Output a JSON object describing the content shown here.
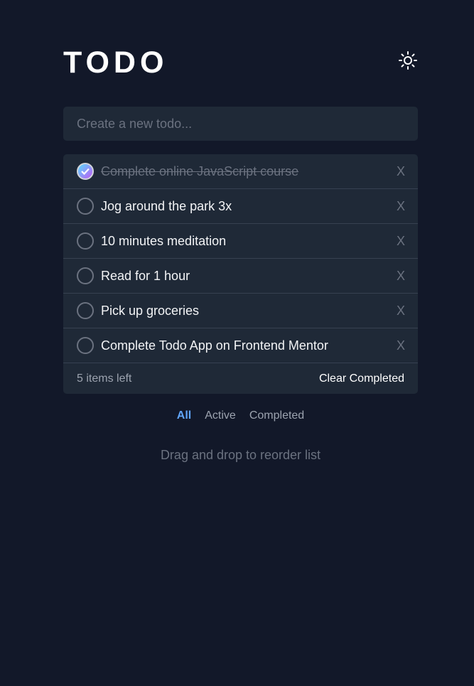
{
  "header": {
    "title": "TODO",
    "theme_icon": "sun-icon"
  },
  "new_todo": {
    "placeholder": "Create a new todo..."
  },
  "todos": [
    {
      "text": "Complete online JavaScript course",
      "completed": true,
      "delete_label": "X"
    },
    {
      "text": "Jog around the park 3x",
      "completed": false,
      "delete_label": "X"
    },
    {
      "text": "10 minutes meditation",
      "completed": false,
      "delete_label": "X"
    },
    {
      "text": "Read for 1 hour",
      "completed": false,
      "delete_label": "X"
    },
    {
      "text": "Pick up groceries",
      "completed": false,
      "delete_label": "X"
    },
    {
      "text": "Complete Todo App on Frontend Mentor",
      "completed": false,
      "delete_label": "X"
    }
  ],
  "footer": {
    "items_left": "5 items left",
    "clear_label": "Clear Completed"
  },
  "filters": {
    "all": "All",
    "active": "Active",
    "completed": "Completed",
    "selected": "all"
  },
  "hint": "Drag and drop to reorder list",
  "colors": {
    "background": "#121829",
    "panel": "#1f2937",
    "accent": "#60a5fa",
    "check_gradient_start": "#57ddff",
    "check_gradient_end": "#c058f3"
  }
}
